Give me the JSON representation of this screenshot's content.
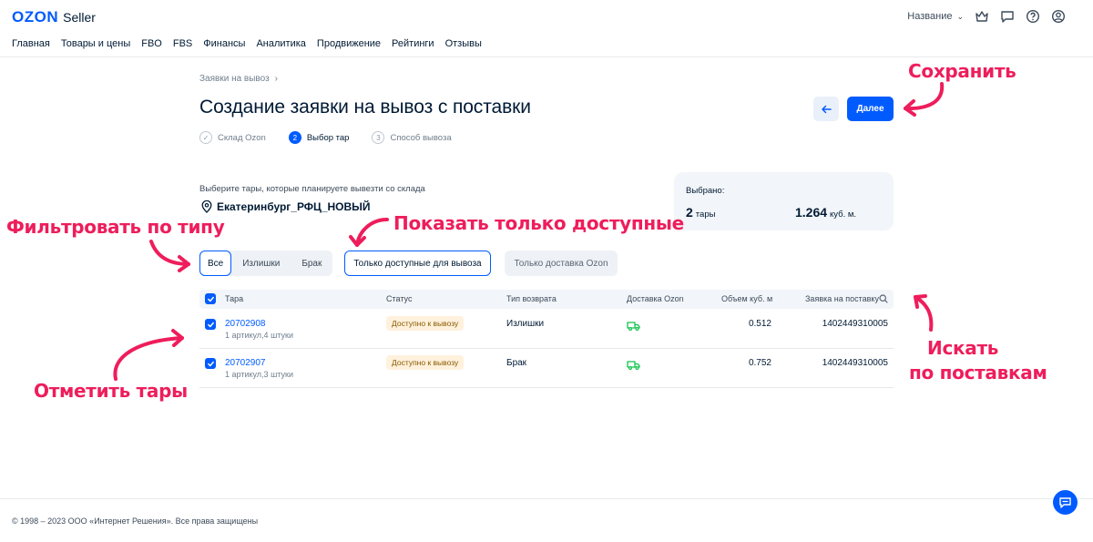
{
  "header": {
    "logo_brand": "OZON",
    "logo_product": "Seller",
    "store_name": "Название",
    "nav": [
      "Главная",
      "Товары и цены",
      "FBO",
      "FBS",
      "Финансы",
      "Аналитика",
      "Продвижение",
      "Рейтинги",
      "Отзывы"
    ],
    "icons": [
      "crown-icon",
      "chat-icon",
      "help-icon",
      "user-icon"
    ]
  },
  "page": {
    "breadcrumb": "Заявки на вывоз",
    "title": "Создание заявки на вывоз с поставки",
    "back_icon": "arrow-left-icon",
    "next_label": "Далее",
    "steps": [
      {
        "num": "✓",
        "label": "Склад Ozon",
        "state": "done"
      },
      {
        "num": "2",
        "label": "Выбор тар",
        "state": "active"
      },
      {
        "num": "3",
        "label": "Способ вывоза",
        "state": "pending"
      }
    ],
    "hint": "Выберите тары, которые планируете вывезти со склада",
    "warehouse": "Екатеринбург_РФЦ_НОВЫЙ"
  },
  "summary": {
    "label": "Выбрано:",
    "count": "2",
    "count_unit": "тары",
    "volume": "1.264",
    "volume_unit": "куб. м."
  },
  "filters": {
    "segments": [
      "Все",
      "Излишки",
      "Брак"
    ],
    "active_segment": "Все",
    "only_available": "Только доступные для вывоза",
    "only_ozon": "Только доставка Ozon"
  },
  "table": {
    "columns": [
      "Тара",
      "Статус",
      "Тип возврата",
      "Доставка Ozon",
      "Объем куб. м",
      "Заявка на поставку"
    ],
    "rows": [
      {
        "id": "20702908",
        "sub": "1 артикул,4 штуки",
        "status": "Доступно к вывозу",
        "type": "Излишки",
        "volume": "0.512",
        "order": "1402449310005"
      },
      {
        "id": "20702907",
        "sub": "1 артикул,3 штуки",
        "status": "Доступно к вывозу",
        "type": "Брак",
        "volume": "0.752",
        "order": "1402449310005"
      }
    ]
  },
  "annotations": {
    "save": "Сохранить",
    "filter_type": "Фильтровать по типу",
    "only_available": "Показать только доступные",
    "search_line1": "Искать",
    "search_line2": "по поставкам",
    "mark": "Отметить тары"
  },
  "footer": {
    "copyright": "© 1998 – 2023 ООО «Интернет Решения». Все права защищены"
  },
  "colors": {
    "brand": "#005bff",
    "annotation": "#ee1d5b",
    "badge_bg": "#fff1dc",
    "delivery_icon": "#10c44c"
  }
}
